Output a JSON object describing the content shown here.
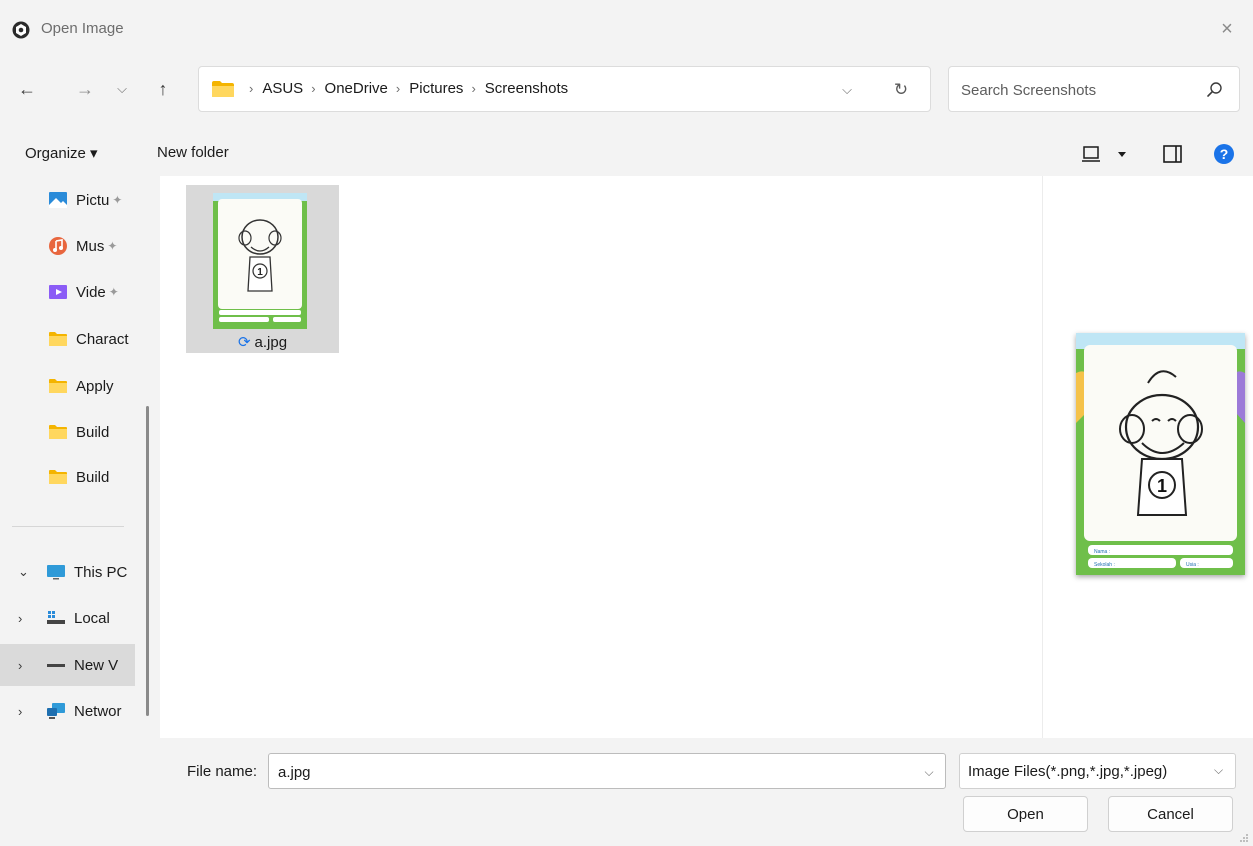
{
  "window": {
    "title": "Open Image",
    "close_icon": "×"
  },
  "nav": {
    "back_icon": "←",
    "forward_icon": "→",
    "recent_icon": "⌵",
    "up_icon": "↑"
  },
  "address": {
    "crumbs": [
      "ASUS",
      "OneDrive",
      "Pictures",
      "Screenshots"
    ],
    "separator": "›",
    "dropdown_icon": "⌵",
    "refresh_icon": "↻"
  },
  "search": {
    "placeholder": "Search Screenshots"
  },
  "toolbar": {
    "organize_label": "Organize ▾",
    "new_folder_label": "New folder"
  },
  "sidebar": {
    "items": [
      {
        "label": "Pictu",
        "pinned": true
      },
      {
        "label": "Mus",
        "pinned": true
      },
      {
        "label": "Vide",
        "pinned": true
      },
      {
        "label": "Charact"
      },
      {
        "label": "Apply"
      },
      {
        "label": "Build"
      },
      {
        "label": "Build"
      },
      {
        "label": "This PC",
        "chevron": "⌄"
      },
      {
        "label": "Local",
        "chevron": "›"
      },
      {
        "label": "New V",
        "chevron": "›"
      },
      {
        "label": "Networ",
        "chevron": "›"
      }
    ],
    "pin_icon": "✦"
  },
  "files": [
    {
      "name": "a.jpg",
      "sync_icon": "⟳"
    }
  ],
  "thumbnail": {
    "number": "1",
    "name_field": "Nama :",
    "school_field": "Sekolah :",
    "age_field": "Usia :"
  },
  "bottom": {
    "filename_label": "File name:",
    "filename_value": "a.jpg",
    "filetype_label": "Image Files(*.png,*.jpg,*.jpeg)",
    "dropdown_icon": "⌵",
    "open_label": "Open",
    "cancel_label": "Cancel"
  },
  "colors": {
    "folder": "#f7c948",
    "accent": "#0067c0",
    "selection": "#d9d9d9"
  }
}
